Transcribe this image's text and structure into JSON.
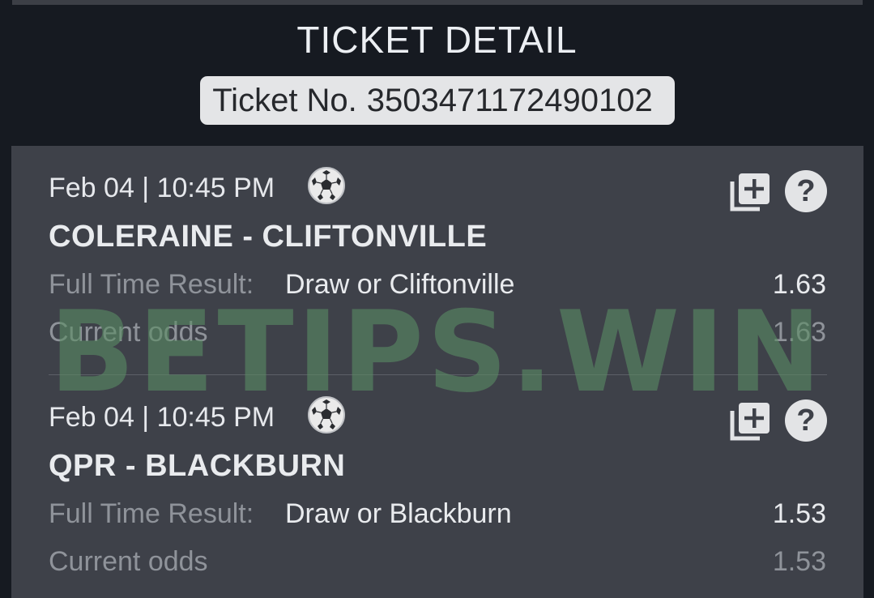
{
  "header": {
    "title": "TICKET DETAIL",
    "ticket_label": "Ticket No.",
    "ticket_number": "3503471172490102"
  },
  "bets": [
    {
      "date": "Feb 04 | 10:45 PM",
      "sport_icon": "soccer-ball-icon",
      "match": "COLERAINE - CLIFTONVILLE",
      "market_label": "Full Time Result:",
      "pick": "Draw or Cliftonville",
      "odds": "1.63",
      "current_odds_label": "Current odds",
      "current_odds": "1.63"
    },
    {
      "date": "Feb 04 | 10:45 PM",
      "sport_icon": "soccer-ball-icon",
      "match": "QPR - BLACKBURN",
      "market_label": "Full Time Result:",
      "pick": "Draw or Blackburn",
      "odds": "1.53",
      "current_odds_label": "Current odds",
      "current_odds": "1.53"
    }
  ],
  "watermark": "BETIPS.WIN",
  "colors": {
    "background": "#161a21",
    "panel": "#3e4149",
    "badge": "#e4e5e7",
    "watermark": "#5a8c64"
  }
}
